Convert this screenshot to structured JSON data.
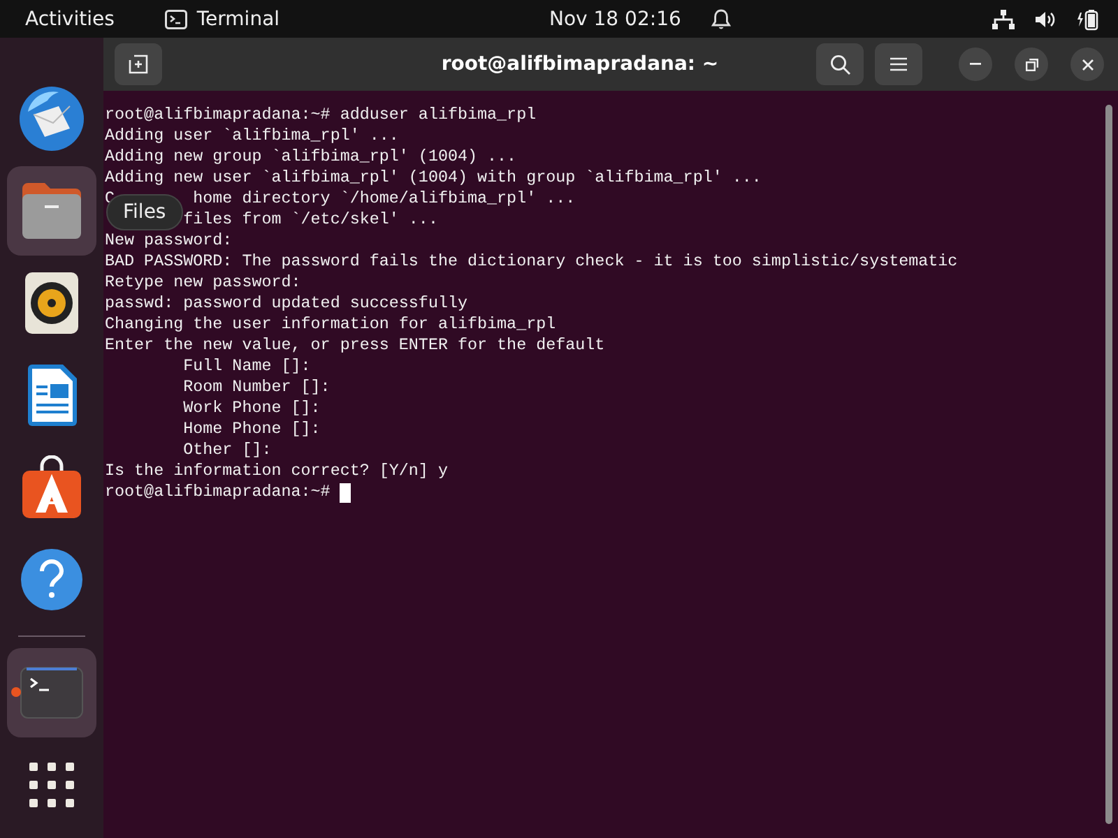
{
  "top_bar": {
    "activities": "Activities",
    "app_name": "Terminal",
    "clock": "Nov 18  02:16"
  },
  "dock": {
    "items": [
      {
        "kind": "mail",
        "running": false,
        "hovered": false
      },
      {
        "kind": "folder",
        "running": false,
        "hovered": true
      },
      {
        "kind": "speaker",
        "running": false,
        "hovered": false
      },
      {
        "kind": "document",
        "running": false,
        "hovered": false
      },
      {
        "kind": "store",
        "running": false,
        "hovered": false
      },
      {
        "kind": "help",
        "running": false,
        "hovered": false
      },
      {
        "kind": "terminal",
        "running": true,
        "hovered": true
      }
    ],
    "tooltip": "Files"
  },
  "window": {
    "title": "root@alifbimapradana: ~",
    "lines": [
      "root@alifbimapradana:~# adduser alifbima_rpl",
      "Adding user `alifbima_rpl' ...",
      "Adding new group `alifbima_rpl' (1004) ...",
      "Adding new user `alifbima_rpl' (1004) with group `alifbima_rpl' ...",
      "C        home directory `/home/alifbima_rpl' ...",
      "        files from `/etc/skel' ...",
      "New password:",
      "BAD PASSWORD: The password fails the dictionary check - it is too simplistic/systematic",
      "Retype new password:",
      "passwd: password updated successfully",
      "Changing the user information for alifbima_rpl",
      "Enter the new value, or press ENTER for the default",
      "        Full Name []:",
      "        Room Number []:",
      "        Work Phone []:",
      "        Home Phone []:",
      "        Other []:",
      "Is the information correct? [Y/n] y",
      "root@alifbimapradana:~# "
    ],
    "cursor": true
  }
}
